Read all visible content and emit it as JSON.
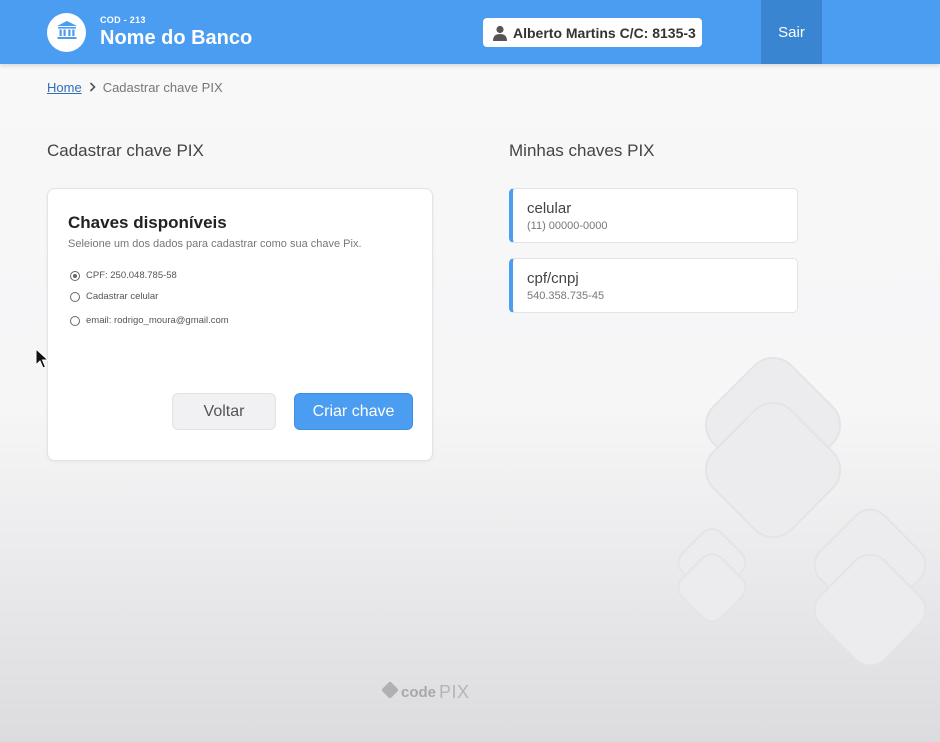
{
  "header": {
    "bank_code": "COD - 213",
    "bank_name": "Nome do Banco",
    "account_text": "Alberto Martins  C/C: 8135-3",
    "logout_label": "Sair",
    "colors": {
      "primary": "#4a9df0",
      "logout_bg": "#3a85d2"
    }
  },
  "breadcrumb": {
    "home": "Home",
    "current": "Cadastrar chave PIX"
  },
  "register_section": {
    "title": "Cadastrar chave PIX",
    "card_title": "Chaves disponíveis",
    "card_subtitle": "Seleione um dos dados para cadastrar como sua chave Pix.",
    "options": [
      {
        "label": "CPF: 250.048.785-58",
        "selected": true
      },
      {
        "label": "Cadastrar celular",
        "selected": false
      },
      {
        "label": "email: rodrigo_moura@gmail.com",
        "selected": false
      }
    ],
    "back_label": "Voltar",
    "create_label": "Criar chave"
  },
  "keys_section": {
    "title": "Minhas chaves PIX",
    "items": [
      {
        "type": "celular",
        "value": "(11) 00000-0000"
      },
      {
        "type": "cpf/cnpj",
        "value": "540.358.735-45"
      }
    ]
  },
  "footer": {
    "logo_code": "code",
    "logo_pix": "PIX"
  },
  "icons": [
    "bank-icon",
    "user-icon",
    "chevron-right-icon",
    "pix-logo-icon",
    "mouse-cursor-icon"
  ]
}
